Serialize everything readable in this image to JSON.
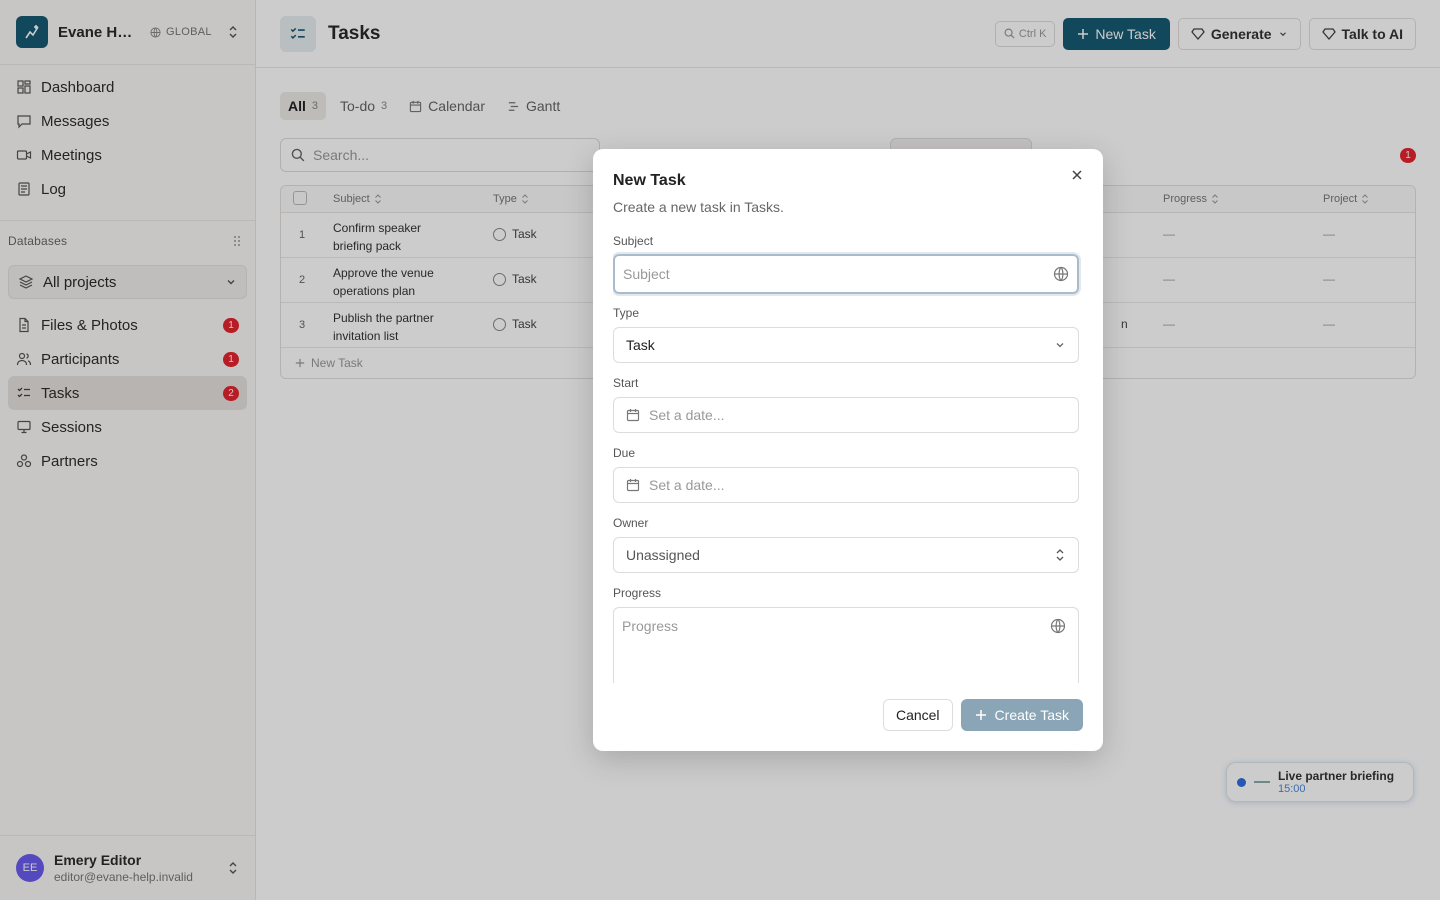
{
  "workspace": {
    "name": "Evane Help Desk",
    "scope": "GLOBAL"
  },
  "nav": [
    {
      "label": "Dashboard",
      "icon": "dashboard-icon"
    },
    {
      "label": "Messages",
      "icon": "message-icon"
    },
    {
      "label": "Meetings",
      "icon": "video-icon"
    },
    {
      "label": "Log",
      "icon": "log-icon"
    }
  ],
  "databases": {
    "heading": "Databases",
    "project_select": "All projects",
    "items": [
      {
        "label": "Files & Photos",
        "badge": "1"
      },
      {
        "label": "Participants",
        "badge": "1"
      },
      {
        "label": "Tasks",
        "badge": "2"
      },
      {
        "label": "Sessions",
        "badge": ""
      },
      {
        "label": "Partners",
        "badge": ""
      }
    ]
  },
  "user": {
    "initials": "EE",
    "name": "Emery Editor",
    "email": "editor@evane-help.invalid"
  },
  "page": {
    "title": "Tasks",
    "shortcut": "Ctrl K",
    "new_task": "New Task",
    "generate": "Generate",
    "talk_to_ai": "Talk to AI",
    "tabs": [
      {
        "label": "All",
        "count": "3"
      },
      {
        "label": "To-do",
        "count": "3"
      },
      {
        "label": "Calendar",
        "count": ""
      },
      {
        "label": "Gantt",
        "count": ""
      }
    ],
    "search_placeholder": "Search...",
    "filter_badge": "1",
    "columns": {
      "subject": "Subject",
      "type": "Type",
      "progress": "Progress",
      "project": "Project"
    },
    "rows": [
      {
        "num": "1",
        "subject": "Confirm speaker briefing pack",
        "type": "Task",
        "extra": "",
        "progress": "—",
        "project": "—"
      },
      {
        "num": "2",
        "subject": "Approve the venue operations plan",
        "type": "Task",
        "extra": "",
        "progress": "—",
        "project": "—"
      },
      {
        "num": "3",
        "subject": "Publish the partner invitation list",
        "type": "Task",
        "extra": "n",
        "progress": "—",
        "project": "—"
      }
    ],
    "new_row": "New Task"
  },
  "toast": {
    "title": "Live partner briefing",
    "time": "15:00"
  },
  "modal": {
    "title": "New Task",
    "description": "Create a new task in Tasks.",
    "subject_label": "Subject",
    "subject_placeholder": "Subject",
    "type_label": "Type",
    "type_value": "Task",
    "start_label": "Start",
    "start_placeholder": "Set a date...",
    "due_label": "Due",
    "due_placeholder": "Set a date...",
    "owner_label": "Owner",
    "owner_value": "Unassigned",
    "progress_label": "Progress",
    "progress_placeholder": "Progress",
    "cancel": "Cancel",
    "create": "Create Task"
  },
  "colors": {
    "brand": "#175a73",
    "badge": "#e5252e",
    "create_disabled": "#8aa5b5"
  }
}
